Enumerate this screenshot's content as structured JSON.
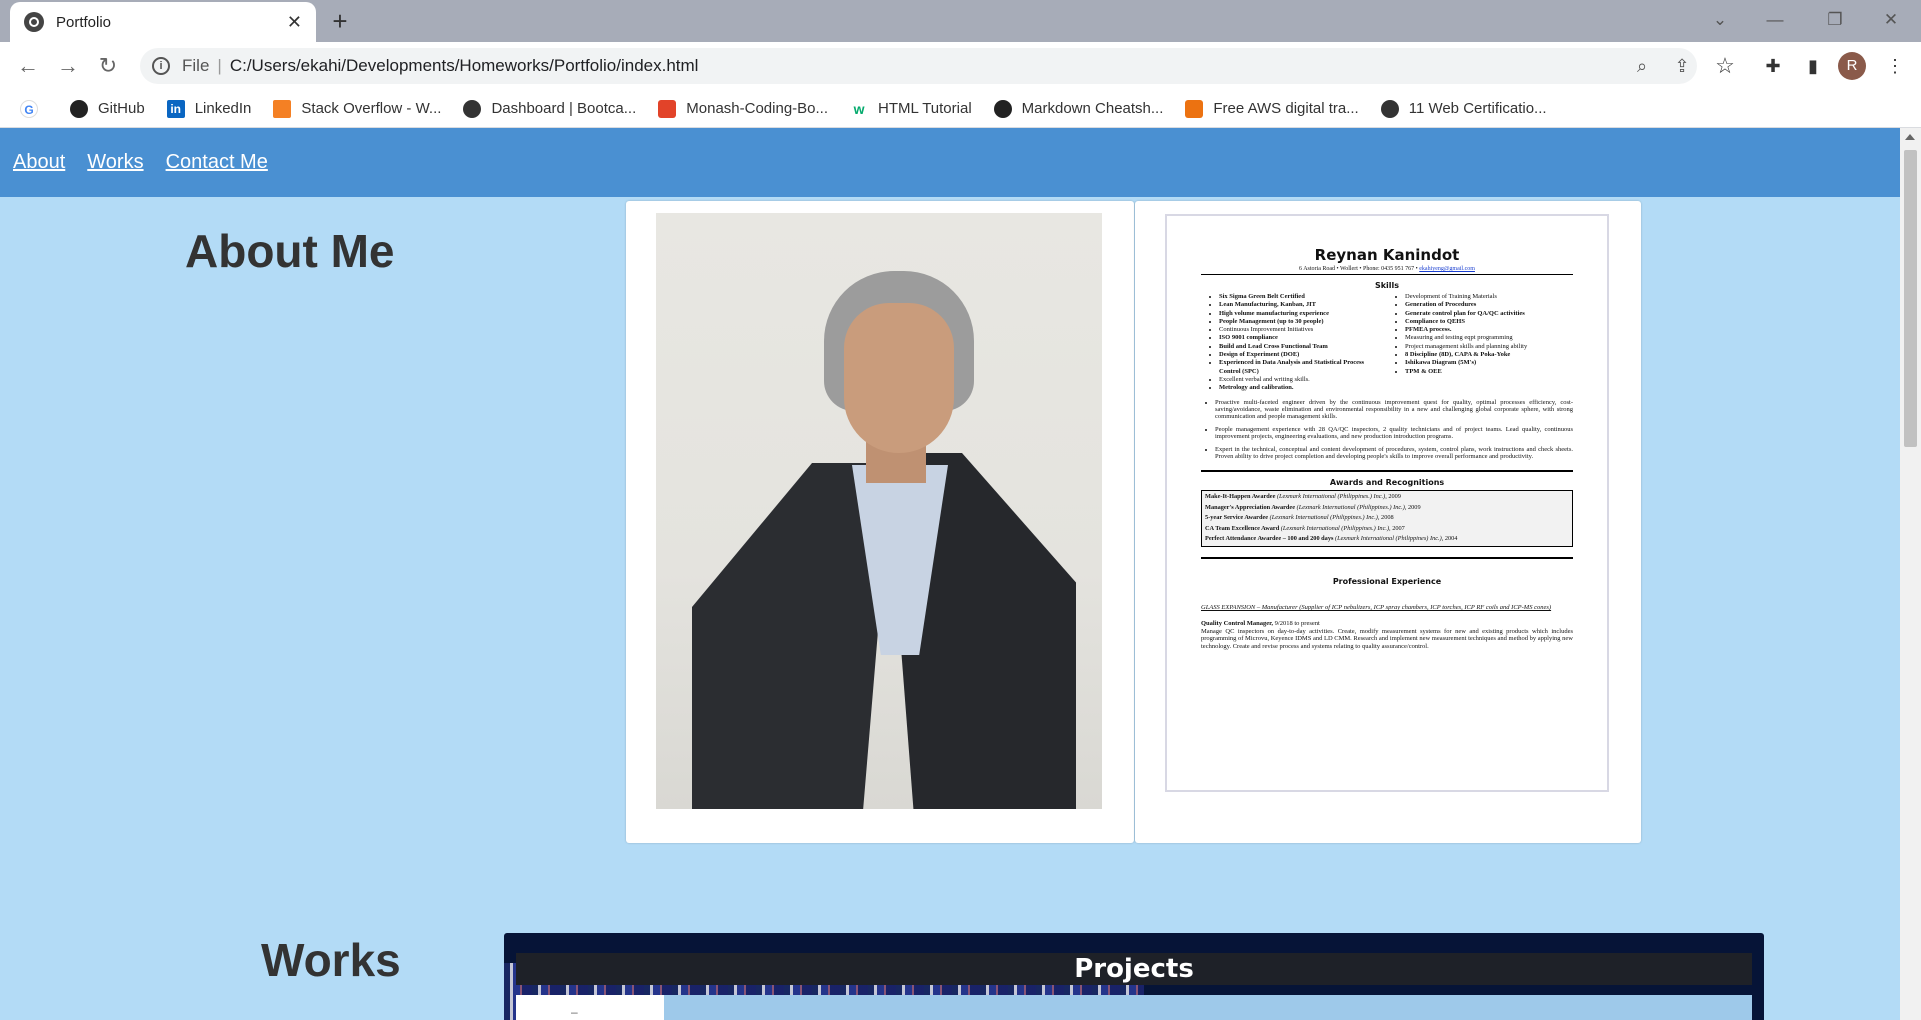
{
  "browser": {
    "tab_title": "Portfolio",
    "tab_close": "✕",
    "new_tab": "+",
    "window_controls": [
      "⌄",
      "—",
      "❐",
      "✕"
    ],
    "nav": {
      "back": "←",
      "forward": "→",
      "reload": "↻"
    },
    "address": {
      "scheme": "File",
      "separator": "|",
      "url": "C:/Users/ekahi/Developments/Homeworks/Portfolio/index.html"
    },
    "omnibox_icons": [
      "zoom-icon",
      "share-icon",
      "bookmark-star-icon"
    ],
    "avatar_letter": "R",
    "bookmarks": [
      {
        "label": "GitHub",
        "icon": "github-icon",
        "color": "#222"
      },
      {
        "label": "LinkedIn",
        "icon": "linkedin-icon",
        "color": "#0a66c2"
      },
      {
        "label": "Stack Overflow - W...",
        "icon": "stackoverflow-icon",
        "color": "#f48024"
      },
      {
        "label": "Dashboard | Bootca...",
        "icon": "globe-icon",
        "color": "#333"
      },
      {
        "label": "Monash-Coding-Bo...",
        "icon": "gitlab-icon",
        "color": "#e24329"
      },
      {
        "label": "HTML Tutorial",
        "icon": "w3schools-icon",
        "color": "#04aa6d"
      },
      {
        "label": "Markdown Cheatsh...",
        "icon": "github-icon",
        "color": "#222"
      },
      {
        "label": "Free AWS digital tra...",
        "icon": "aws-icon",
        "color": "#ec7211"
      },
      {
        "label": "11 Web Certificatio...",
        "icon": "globe-icon",
        "color": "#333"
      }
    ]
  },
  "page": {
    "nav_links": [
      "About",
      "Works",
      "Contact Me"
    ],
    "about_heading": "About Me",
    "works_heading": "Works",
    "works_card_title": "Projects",
    "colors": {
      "navbar": "#4a90d2",
      "background": "#b3dbf6"
    }
  },
  "resume": {
    "name": "Reynan Kanindot",
    "contact": "6 Astoria Road  •  Wollert •  Phone: 0435 951 767  •",
    "email": "ekahiyeng@gmail.com",
    "skills_heading": "Skills",
    "skills_left": [
      "Six Sigma Green Belt Certified",
      "Lean Manufacturing, Kanban, JIT",
      "High volume manufacturing experience",
      "People Management (up to 30 people)",
      "Continuous Improvement Initiatives",
      "ISO 9001 compliance",
      "Build and Lead Cross Functional Team",
      "Design of Experiment (DOE)",
      "Experienced in Data Analysis and Statistical Process Control (SPC)",
      "Excellent verbal and writing skills.",
      "Metrology and calibration."
    ],
    "skills_right": [
      "Development of Training Materials",
      "Generation of Procedures",
      "Generate control plan for QA/QC activities",
      "Compliance to QEHS",
      "PFMEA process.",
      "Measuring and testing eqpt programming",
      "Project management skills and planning ability",
      "8 Discipline (8D), CAPA & Poka-Yoke",
      "Ishikawa Diagram (5M's)",
      "TPM & OEE"
    ],
    "summary": [
      "Proactive multi-faceted engineer driven by the continuous improvement quest for quality, optimal processes efficiency, cost-saving/avoidance, waste elimination and environmental responsibility in a new and challenging global corporate sphere, with strong communication and people management skills.",
      "People management experience with 28 QA/QC inspectors, 2 quality technicians and of project teams. Lead quality, continuous improvement projects, engineering evaluations, and new production introduction programs.",
      "Expert in the technical, conceptual and content development of procedures, system, control plans, work instructions and check sheets. Proven ability to drive project completion and developing people's skills to improve overall performance and productivity."
    ],
    "awards_heading": "Awards and Recognitions",
    "awards": [
      {
        "title": "Make-It-Happen Awardee",
        "org": "(Lexmark International (Philippines.) Inc.)",
        "year": ", 2009"
      },
      {
        "title": "Manager's Appreciation Awardee",
        "org": "(Lexmark International (Philippines.) Inc.)",
        "year": ", 2009"
      },
      {
        "title": "5-year Service Awardee",
        "org": "(Lexmark International (Philippines.) Inc.)",
        "year": ", 2008"
      },
      {
        "title": "CA Team Excellence Award",
        "org": "(Lexmark International (Philippines.) Inc.)",
        "year": ", 2007"
      },
      {
        "title": "Perfect Attendance Awardee – 100 and 200 days",
        "org": "(Lexmark International (Philippines) Inc.)",
        "year": ", 2004"
      }
    ],
    "experience_heading": "Professional Experience",
    "company": "GLASS EXPANSION – Manufacturer (Supplier of ICP nebulizers, ICP spray chambers, ICP torches, ICP RF coils and ICP-MS cones)",
    "role": "Quality Control Manager,",
    "role_dates": " 9/2018 to present",
    "role_desc": "Manage QC inspectors on day-to-day activities. Create, modify measurement systems for new and existing products which includes programming of Microvu, Keyence IDMS and LD CMM. Research and implement new measurement techniques and method by applying new technology. Create and revise process and systems relating to quality assurance/control."
  }
}
